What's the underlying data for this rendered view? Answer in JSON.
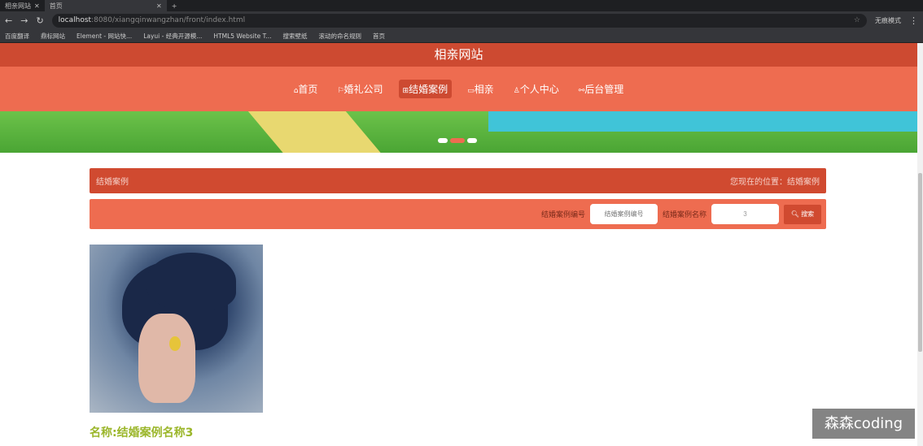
{
  "browser": {
    "tabs": [
      {
        "label": "相亲网站"
      },
      {
        "label": "首页"
      }
    ],
    "url_host": "localhost",
    "url_rest": ":8080/xiangqinwangzhan/front/index.html",
    "profile": "无痕模式",
    "bookmarks": [
      "百度翻译",
      "鼎标网站",
      "Element - 网站快...",
      "Layui - 经典开源模...",
      "HTML5 Website T...",
      "搜索壁纸",
      "滚动的命名规则",
      "首页"
    ]
  },
  "site": {
    "title": "相亲网站"
  },
  "nav": [
    {
      "icon": "⌂",
      "label": "首页"
    },
    {
      "icon": "⚐",
      "label": "婚礼公司"
    },
    {
      "icon": "⊞",
      "label": "结婚案例",
      "active": true
    },
    {
      "icon": "▭",
      "label": "相亲"
    },
    {
      "icon": "♙",
      "label": "个人中心"
    },
    {
      "icon": "⚯",
      "label": "后台管理"
    }
  ],
  "breadcrumb": {
    "title": "结婚案例",
    "location": "您现在的位置：结婚案例"
  },
  "search": {
    "field1_label": "结婚案例编号",
    "field1_placeholder": "结婚案例编号",
    "field1_value": "",
    "field2_label": "结婚案例名称",
    "field2_value": "3",
    "button": "搜索"
  },
  "items": [
    {
      "caption": "名称:结婚案例名称3"
    }
  ],
  "watermark": "森森coding"
}
